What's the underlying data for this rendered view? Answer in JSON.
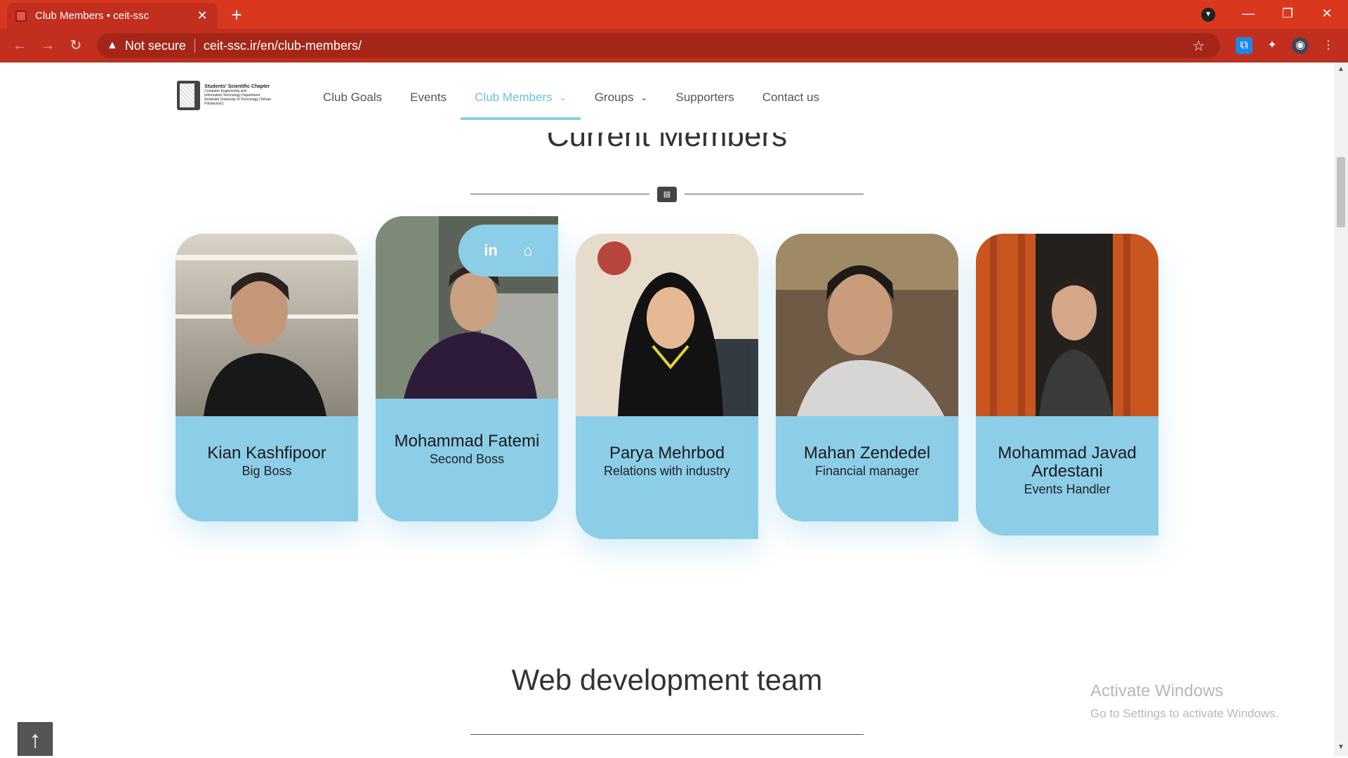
{
  "browser": {
    "tab_title": "Club Members • ceit-ssc",
    "security_label": "Not secure",
    "url": "ceit-ssc.ir/en/club-members/"
  },
  "site": {
    "logo_title": "Students' Scientific Chapter",
    "logo_line2": "Computer Engineering and",
    "logo_line3": "Information Technology Department",
    "logo_line4": "Amirkabir University of Technology (Tehran Polytechnic)",
    "menu": [
      {
        "label": "Club Goals"
      },
      {
        "label": "Events"
      },
      {
        "label": "Club Members"
      },
      {
        "label": "Groups"
      },
      {
        "label": "Supporters"
      },
      {
        "label": "Contact us"
      }
    ]
  },
  "sections": {
    "current_members_title": "Current Members",
    "web_team_title": "Web development team"
  },
  "members": [
    {
      "name": "Kian Kashfipoor",
      "role": "Big Boss"
    },
    {
      "name": "Mohammad Fatemi",
      "role": "Second Boss"
    },
    {
      "name": "Parya Mehrbod",
      "role": "Relations with industry"
    },
    {
      "name": "Mahan Zendedel",
      "role": "Financial manager"
    },
    {
      "name": "Mohammad Javad Ardestani",
      "role": "Events Handler"
    }
  ],
  "windows_watermark": {
    "line1": "Activate Windows",
    "line2": "Go to Settings to activate Windows."
  },
  "icons": {
    "section_divider": "id-card-icon",
    "social": [
      "linkedin-icon",
      "home-icon"
    ],
    "back_to_top": "arrow-up-icon"
  },
  "colors": {
    "browser_chrome": "#d9381e",
    "card_accent": "#8ccde7",
    "active_menu": "#6cbfe3"
  }
}
